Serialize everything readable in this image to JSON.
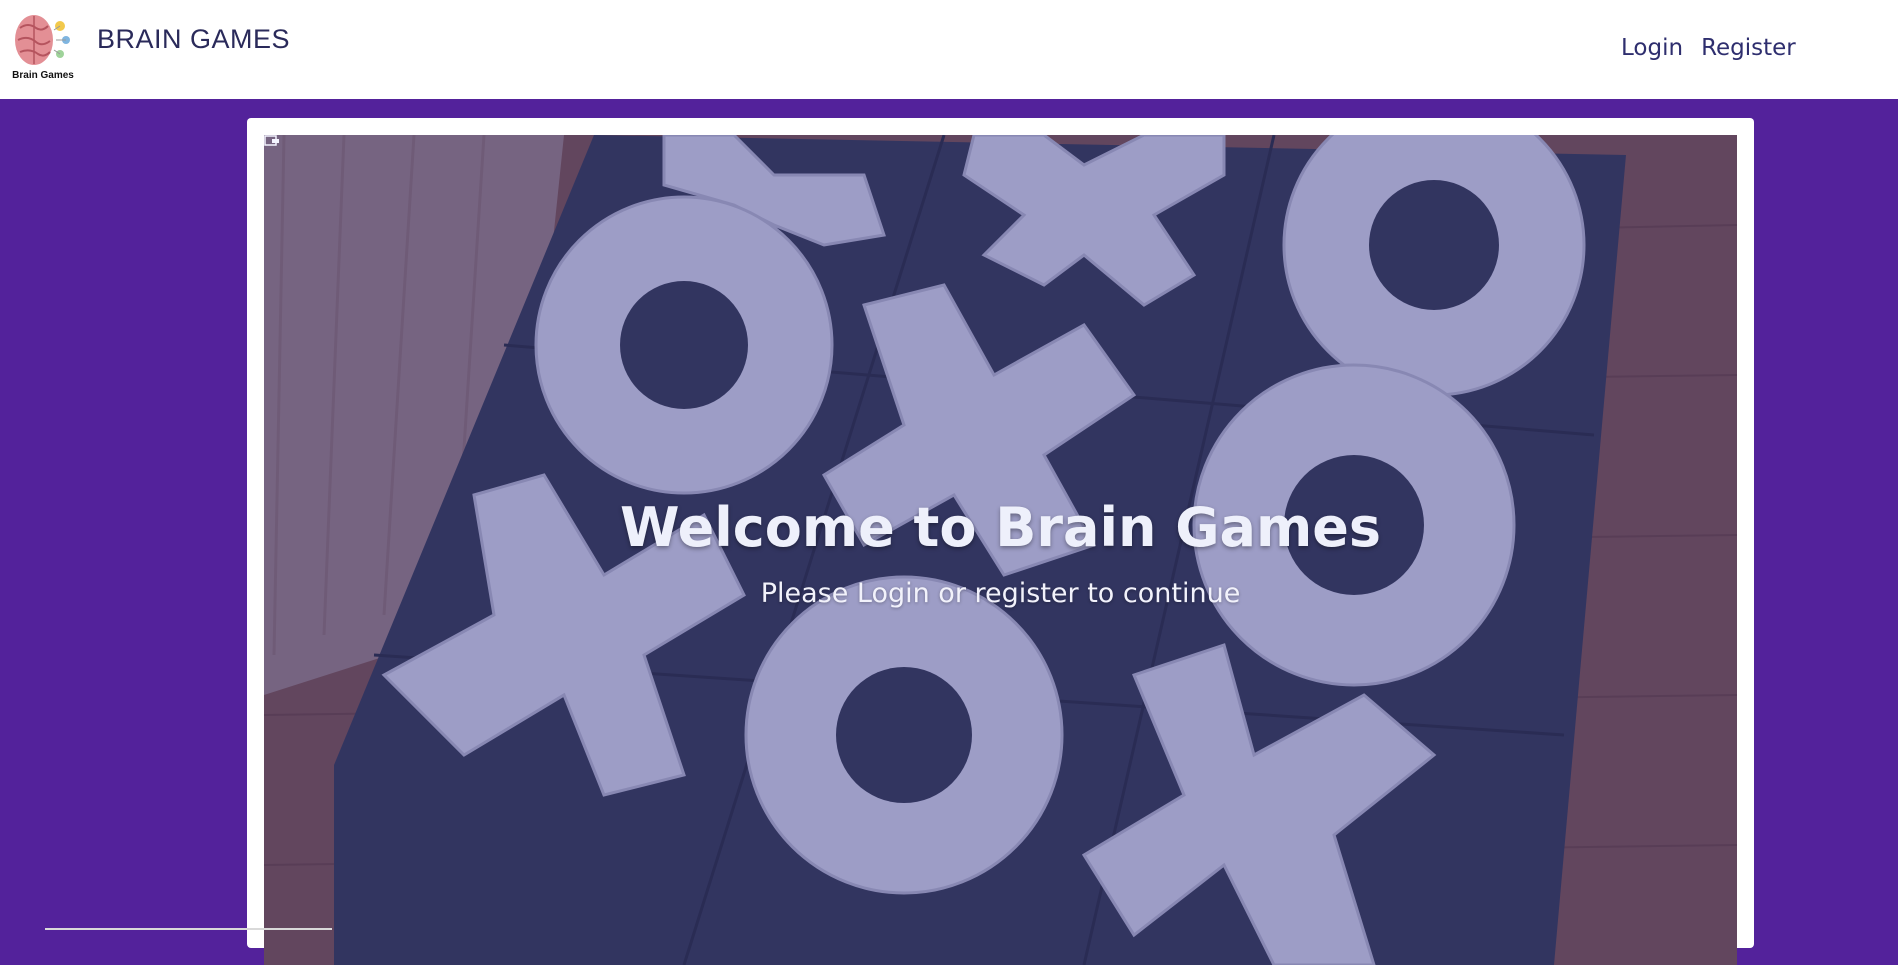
{
  "navbar": {
    "logo_caption": "Brain Games",
    "brand": "BRAIN GAMES",
    "links": {
      "login": "Login",
      "register": "Register"
    }
  },
  "hero": {
    "title": "Welcome to Brain Games",
    "subtitle": "Please Login or register to continue"
  },
  "colors": {
    "page_background": "#53229b",
    "navbar_background": "#ffffff",
    "brand_text": "#2a2a5a",
    "nav_link": "#2e2e6e"
  },
  "icons": {
    "logo": "brain-logo-icon",
    "cursor": "cursor-icon"
  }
}
